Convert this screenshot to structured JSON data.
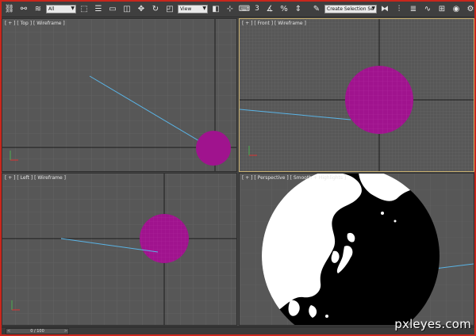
{
  "toolbar": {
    "selection_filter": "All",
    "reference_coord": "View",
    "named_selection": "Create Selection Se",
    "icons": [
      "undo-icon",
      "redo-icon",
      "link-icon",
      "unlink-icon",
      "bind-space-warp-icon",
      "select-object-icon",
      "select-by-name-icon",
      "rect-selection-icon",
      "window-crossing-icon",
      "move-icon",
      "rotate-icon",
      "scale-icon",
      "pivot-icon",
      "select-manipulate-icon",
      "keyboard-shortcut-icon",
      "snap-3-icon",
      "angle-snap-icon",
      "percent-snap-icon",
      "spinner-snap-icon",
      "edit-named-selection-icon",
      "mirror-icon",
      "align-icon",
      "layer-manager-icon",
      "curve-editor-icon",
      "schematic-view-icon",
      "material-editor-icon",
      "render-setup-icon",
      "render-frame-icon"
    ],
    "snap_label": "3"
  },
  "viewports": {
    "top": {
      "label": "[ + ] [ Top ] [ Wireframe ]"
    },
    "front": {
      "label": "[ + ] [ Front ] [ Wireframe ]"
    },
    "left": {
      "label": "[ + ] [ Left ] [ Wireframe ]"
    },
    "perspective": {
      "label": "[ + ] [ Perspective ] [ Smooth + Highlights ]"
    }
  },
  "timebar": {
    "frame": "0 / 100",
    "left": "<",
    "right": ">"
  },
  "watermark": "pxleyes.com",
  "colors": {
    "frame": "#c9261c",
    "sphere": "#a0138e",
    "light_line": "#5ab4e6",
    "active_border": "#c8b070",
    "grid_bg": "#575757"
  }
}
